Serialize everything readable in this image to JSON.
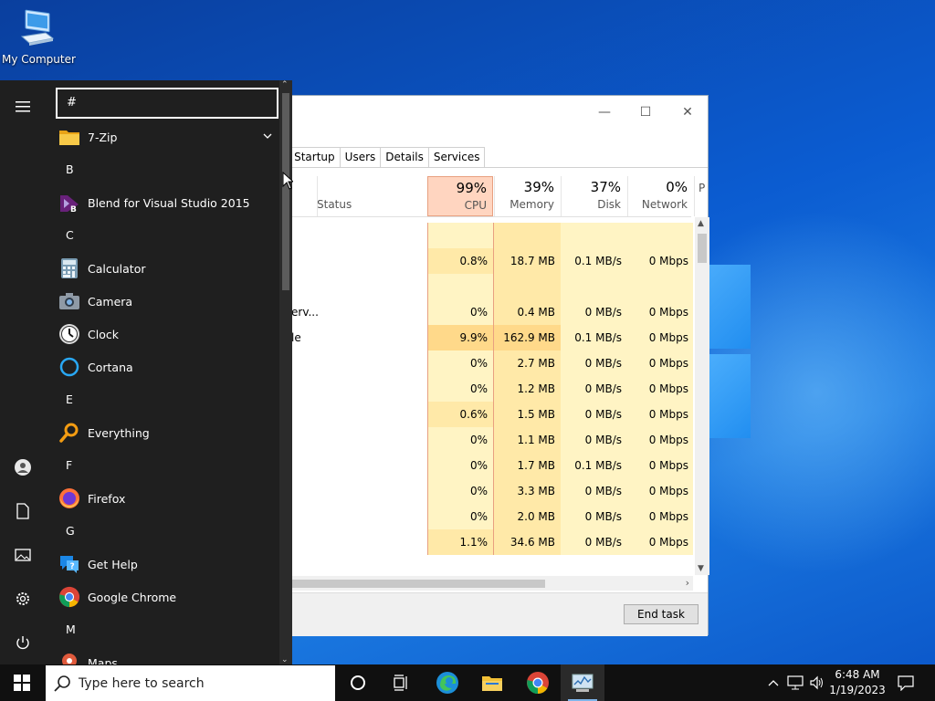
{
  "desktop": {
    "icons": [
      {
        "label": "My Computer",
        "icon": "computer-icon"
      }
    ]
  },
  "task_manager": {
    "tabs": [
      "y",
      "Startup",
      "Users",
      "Details",
      "Services"
    ],
    "status_header": "Status",
    "columns": [
      {
        "key": "cpu",
        "percent": "99%",
        "name": "CPU"
      },
      {
        "key": "memory",
        "percent": "39%",
        "name": "Memory"
      },
      {
        "key": "disk",
        "percent": "37%",
        "name": "Disk"
      },
      {
        "key": "network",
        "percent": "0%",
        "name": "Network"
      },
      {
        "key": "power",
        "percent": "",
        "name": "P"
      }
    ],
    "rows": [
      {
        "name": "",
        "cpu": "",
        "memory": "",
        "disk": "",
        "network": ""
      },
      {
        "name": "",
        "cpu": "0.8%",
        "memory": "18.7 MB",
        "disk": "0.1 MB/s",
        "network": "0 Mbps"
      },
      {
        "name": "",
        "cpu": "",
        "memory": "",
        "disk": "",
        "network": ""
      },
      {
        "name": "erv...",
        "cpu": "0%",
        "memory": "0.4 MB",
        "disk": "0 MB/s",
        "network": "0 Mbps"
      },
      {
        "name": "le",
        "cpu": "9.9%",
        "memory": "162.9 MB",
        "disk": "0.1 MB/s",
        "network": "0 Mbps"
      },
      {
        "name": "",
        "cpu": "0%",
        "memory": "2.7 MB",
        "disk": "0 MB/s",
        "network": "0 Mbps"
      },
      {
        "name": "",
        "cpu": "0%",
        "memory": "1.2 MB",
        "disk": "0 MB/s",
        "network": "0 Mbps"
      },
      {
        "name": "",
        "cpu": "0.6%",
        "memory": "1.5 MB",
        "disk": "0 MB/s",
        "network": "0 Mbps"
      },
      {
        "name": "",
        "cpu": "0%",
        "memory": "1.1 MB",
        "disk": "0 MB/s",
        "network": "0 Mbps"
      },
      {
        "name": "",
        "cpu": "0%",
        "memory": "1.7 MB",
        "disk": "0.1 MB/s",
        "network": "0 Mbps"
      },
      {
        "name": "",
        "cpu": "0%",
        "memory": "3.3 MB",
        "disk": "0 MB/s",
        "network": "0 Mbps"
      },
      {
        "name": "",
        "cpu": "0%",
        "memory": "2.0 MB",
        "disk": "0 MB/s",
        "network": "0 Mbps"
      },
      {
        "name": "",
        "cpu": "1.1%",
        "memory": "34.6 MB",
        "disk": "0 MB/s",
        "network": "0 Mbps"
      }
    ],
    "end_task_label": "End task",
    "colors": {
      "cpu_header": "#ffd5c0",
      "cell_light": "#fff4c4",
      "cell_mid": "#ffe9a8",
      "cell_dark": "#ffd98a"
    }
  },
  "start_menu": {
    "search_value": "#",
    "rail": [
      {
        "name": "hamburger-icon"
      },
      {
        "name": "user-icon"
      },
      {
        "name": "documents-icon"
      },
      {
        "name": "pictures-icon"
      },
      {
        "name": "settings-icon"
      },
      {
        "name": "power-icon"
      }
    ],
    "entries": [
      {
        "type": "app",
        "label": "7-Zip",
        "icon": "folder-icon",
        "expand": true
      },
      {
        "type": "letter",
        "label": "B"
      },
      {
        "type": "app",
        "label": "Blend for Visual Studio 2015",
        "icon": "blend-icon"
      },
      {
        "type": "letter",
        "label": "C"
      },
      {
        "type": "app",
        "label": "Calculator",
        "icon": "calculator-icon"
      },
      {
        "type": "app",
        "label": "Camera",
        "icon": "camera-icon"
      },
      {
        "type": "app",
        "label": "Clock",
        "icon": "clock-icon"
      },
      {
        "type": "app",
        "label": "Cortana",
        "icon": "cortana-icon"
      },
      {
        "type": "letter",
        "label": "E"
      },
      {
        "type": "app",
        "label": "Everything",
        "icon": "everything-icon"
      },
      {
        "type": "letter",
        "label": "F"
      },
      {
        "type": "app",
        "label": "Firefox",
        "icon": "firefox-icon"
      },
      {
        "type": "letter",
        "label": "G"
      },
      {
        "type": "app",
        "label": "Get Help",
        "icon": "get-help-icon"
      },
      {
        "type": "app",
        "label": "Google Chrome",
        "icon": "chrome-icon"
      },
      {
        "type": "letter",
        "label": "M"
      },
      {
        "type": "app",
        "label": "Maps",
        "icon": "maps-icon"
      }
    ]
  },
  "taskbar": {
    "search_placeholder": "Type here to search",
    "clock_time": "6:48 AM",
    "clock_date": "1/19/2023"
  }
}
